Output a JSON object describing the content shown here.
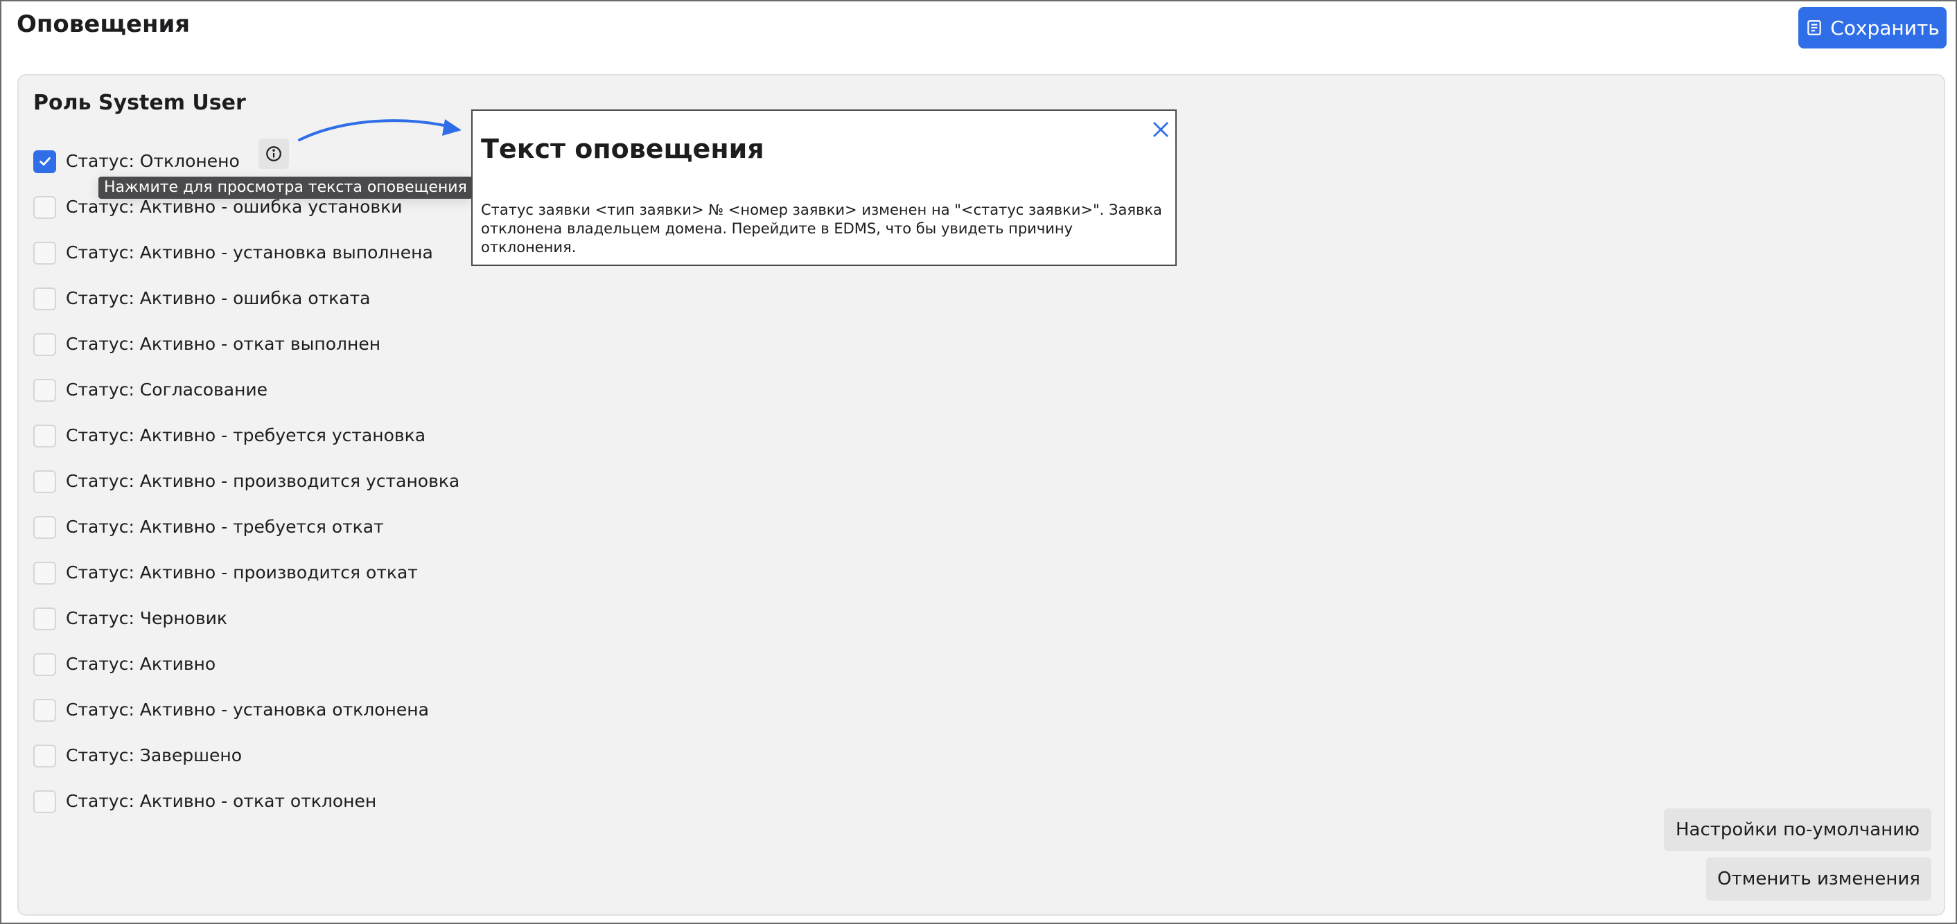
{
  "header": {
    "title": "Оповещения",
    "save_label": "Сохранить",
    "save_icon": "save-icon"
  },
  "role": {
    "title": "Роль System User"
  },
  "statuses": [
    {
      "label": "Статус: Отклонено",
      "checked": true
    },
    {
      "label": "Статус: Активно - ошибка установки",
      "checked": false
    },
    {
      "label": "Статус: Активно - установка выполнена",
      "checked": false
    },
    {
      "label": "Статус: Активно - ошибка отката",
      "checked": false
    },
    {
      "label": "Статус: Активно - откат выполнен",
      "checked": false
    },
    {
      "label": "Статус: Согласование",
      "checked": false
    },
    {
      "label": "Статус: Активно - требуется установка",
      "checked": false
    },
    {
      "label": "Статус: Активно - производится установка",
      "checked": false
    },
    {
      "label": "Статус: Активно - требуется откат",
      "checked": false
    },
    {
      "label": "Статус: Активно - производится откат",
      "checked": false
    },
    {
      "label": "Статус: Черновик",
      "checked": false
    },
    {
      "label": "Статус: Активно",
      "checked": false
    },
    {
      "label": "Статус: Активно - установка отклонена",
      "checked": false
    },
    {
      "label": "Статус: Завершено",
      "checked": false
    },
    {
      "label": "Статус: Активно - откат отклонен",
      "checked": false
    }
  ],
  "tooltip": {
    "text": "Нажмите для просмотра текста оповещения"
  },
  "popup": {
    "title": "Текст оповещения",
    "text": "Статус заявки <тип заявки> № <номер заявки> изменен на \"<статус заявки>\". Заявка отклонена владельцем домена. Перейдите в EDMS, что бы увидеть причину отклонения."
  },
  "footer": {
    "defaults_label": "Настройки по-умолчанию",
    "cancel_label": "Отменить изменения"
  },
  "colors": {
    "accent": "#2f6ee6",
    "panel_bg": "#f2f2f2",
    "button_bg": "#e4e4e4",
    "tooltip_bg": "#4a4a4c"
  }
}
